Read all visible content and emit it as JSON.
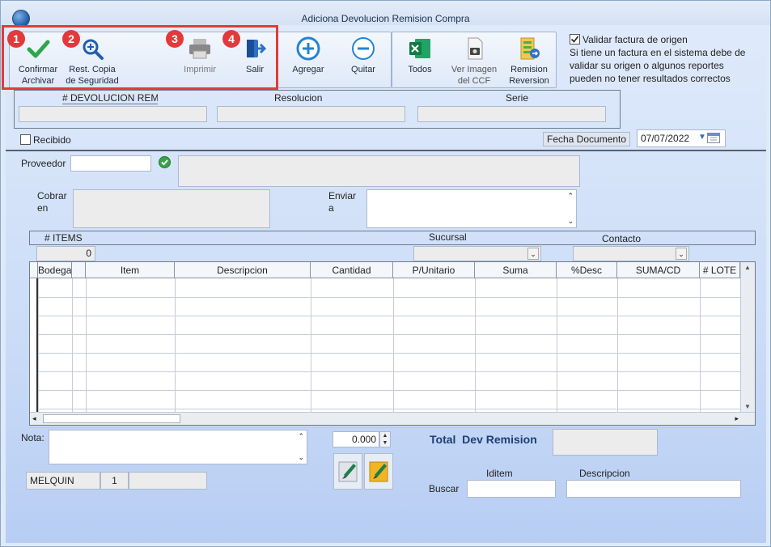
{
  "window": {
    "title": "Adiciona Devolucion Remision Compra"
  },
  "toolbar": {
    "confirm": {
      "line1": "Confirmar",
      "line2": "Archivar"
    },
    "restore": {
      "line1": "Rest. Copia",
      "line2": "de Seguridad"
    },
    "print": {
      "label": "Imprimir"
    },
    "exit": {
      "label": "Salir"
    },
    "add": {
      "label": "Agregar"
    },
    "remove": {
      "label": "Quitar"
    },
    "all": {
      "label": "Todos"
    },
    "view_image": {
      "line1": "Ver Imagen",
      "line2": "del CCF"
    },
    "remision": {
      "line1": "Remision",
      "line2": "Reversion"
    },
    "badges": [
      "1",
      "2",
      "3",
      "4"
    ]
  },
  "validate": {
    "label": "Validar factura de origen",
    "checked": true,
    "note_lines": [
      "Si tiene un factura en el sistema debe de",
      "validar su origen o algunos reportes",
      "pueden no tener resultados correctos"
    ]
  },
  "header": {
    "devolucion_label": "# DEVOLUCION REM",
    "resolucion_label": "Resolucion",
    "serie_label": "Serie",
    "devolucion_value": "",
    "resolucion_value": "",
    "serie_value": ""
  },
  "recibido": {
    "label": "Recibido",
    "checked": false
  },
  "fecha": {
    "label": "Fecha Documento",
    "value": "07/07/2022"
  },
  "proveedor": {
    "label": "Proveedor",
    "code": "",
    "name": ""
  },
  "cobrar": {
    "line1": "Cobrar",
    "line2": "en"
  },
  "enviar": {
    "line1": "Enviar",
    "line2": "a"
  },
  "items_bar": {
    "items_label": "# ITEMS",
    "items_count": "0",
    "sucursal_label": "Sucursal",
    "contacto_label": "Contacto"
  },
  "grid": {
    "columns": [
      "Bodega",
      "Item",
      "Descripcion",
      "Cantidad",
      "P/Unitario",
      "Suma",
      "%Desc",
      "SUMA/CD",
      "# LOTE"
    ]
  },
  "nota": {
    "label": "Nota:",
    "value": ""
  },
  "amount": {
    "value": "0.000"
  },
  "user": {
    "name": "MELQUIN",
    "number": "1",
    "extra": ""
  },
  "total": {
    "label": "Total  Dev Remision",
    "value": ""
  },
  "buscar": {
    "label": "Buscar",
    "iditem_label": "Iditem",
    "descripcion_label": "Descripcion"
  },
  "colors": {
    "accent": "#e23a3a",
    "title_blue": "#1d3f73"
  }
}
